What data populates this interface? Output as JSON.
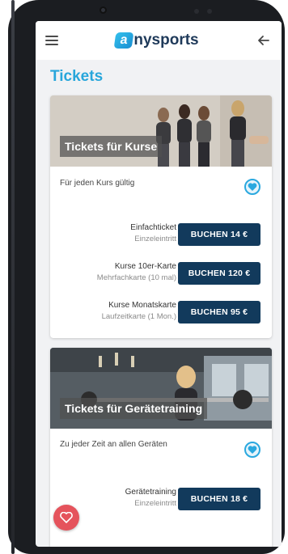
{
  "header": {
    "logo_mark": "a",
    "logo_text": "nysports",
    "icons": [
      "menu-icon",
      "back-arrow-icon"
    ]
  },
  "page": {
    "title": "Tickets"
  },
  "cards": [
    {
      "hero_label": "Tickets für Kurse",
      "subtitle": "Für jeden Kurs gültig",
      "tickets": [
        {
          "name": "Einfachticket",
          "sub": "Einzeleintritt",
          "button": "BUCHEN 14 €"
        },
        {
          "name": "Kurse 10er-Karte",
          "sub": "Mehrfachkarte (10 mal)",
          "button": "BUCHEN 120 €"
        },
        {
          "name": "Kurse Monatskarte",
          "sub": "Laufzeitkarte (1 Mon.)",
          "button": "BUCHEN 95 €"
        }
      ]
    },
    {
      "hero_label": "Tickets für Gerätetraining",
      "subtitle": "Zu jeder Zeit an allen Geräten",
      "tickets": [
        {
          "name": "Gerätetraining",
          "sub": "Einzeleintritt",
          "button": "BUCHEN 18 €"
        }
      ]
    }
  ],
  "colors": {
    "accent": "#27a6db",
    "button": "#123a5c",
    "fab": "#e5535c"
  }
}
